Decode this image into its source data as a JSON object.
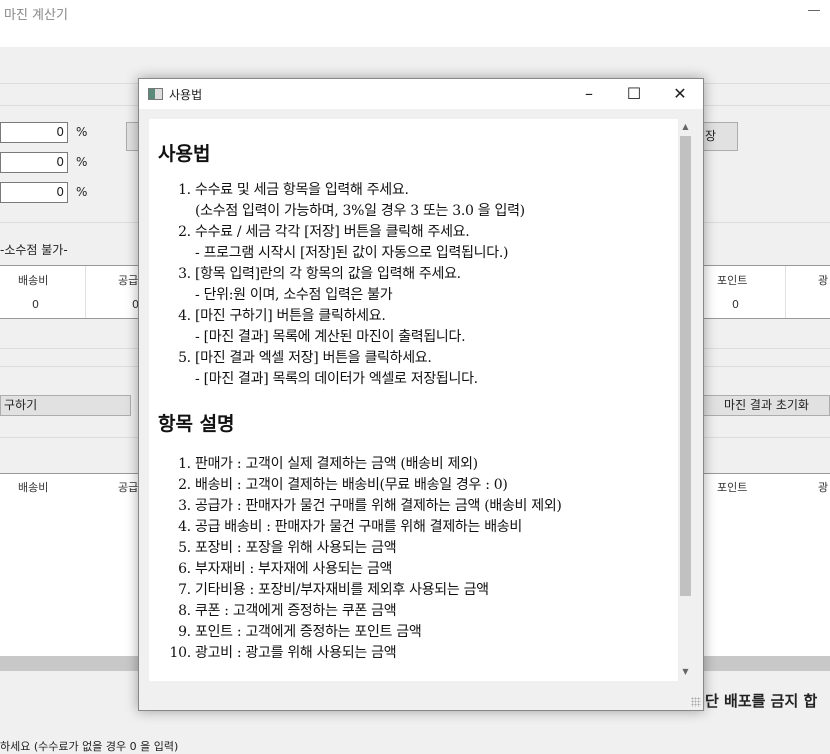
{
  "app": {
    "title": "마진 계산기",
    "rate_values": [
      "0",
      "0",
      "0"
    ],
    "percent": "%",
    "save_partial": "장",
    "decimal_note": "-소수점 불가-",
    "table1": {
      "headers": [
        "배송비",
        "공급",
        "포인트",
        "광"
      ],
      "values": [
        "0",
        "0",
        "0"
      ]
    },
    "calc_button": "구하기",
    "reset_button": "마진 결과 초기화",
    "table2": {
      "headers": [
        "배송비",
        "공급",
        "포인트",
        "광"
      ]
    },
    "notice": "단 배포를 금지 합",
    "hint": "하세요 (수수료가 없을 경우 0 을 입력)"
  },
  "dialog": {
    "title": "사용법",
    "heading1": "사용법",
    "steps": [
      {
        "text": "수수료 및 세금 항목을 입력해 주세요.",
        "sub": "(소수점 입력이 가능하며, 3%일 경우 3 또는 3.0 을 입력)"
      },
      {
        "text": "수수료 / 세금 각각 [저장] 버튼을 클릭해 주세요.",
        "sub": "- 프로그램 시작시 [저장]된 값이 자동으로 입력됩니다.)"
      },
      {
        "text": "[항목 입력]란의 각 항목의 값을 입력해 주세요.",
        "sub": "- 단위:원 이며, 소수점 입력은 불가"
      },
      {
        "text": "[마진 구하기] 버튼을 클릭하세요.",
        "sub": "- [마진 결과] 목록에 계산된 마진이 출력됩니다."
      },
      {
        "text": "[마진 결과 엑셀 저장] 버튼을 클릭하세요.",
        "sub": "- [마진 결과] 목록의 데이터가 엑셀로 저장됩니다."
      }
    ],
    "heading2": "항목 설명",
    "items": [
      "판매가 : 고객이 실제 결제하는 금액 (배송비 제외)",
      "배송비 : 고객이 결제하는 배송비(무료 배송일 경우 : 0)",
      "공급가 : 판매자가 물건 구매를 위해 결제하는 금액 (배송비 제외)",
      "공급 배송비 : 판매자가 물건 구매를 위해 결제하는 배송비",
      "포장비 : 포장을 위해 사용되는 금액",
      "부자재비 : 부자재에 사용되는 금액",
      "기타비용 : 포장비/부자재비를 제외후 사용되는 금액",
      "쿠폰 : 고객에게 증정하는 쿠폰 금액",
      "포인트 : 고객에게 증정하는 포인트 금액",
      "광고비 : 광고를 위해 사용되는 금액"
    ]
  }
}
